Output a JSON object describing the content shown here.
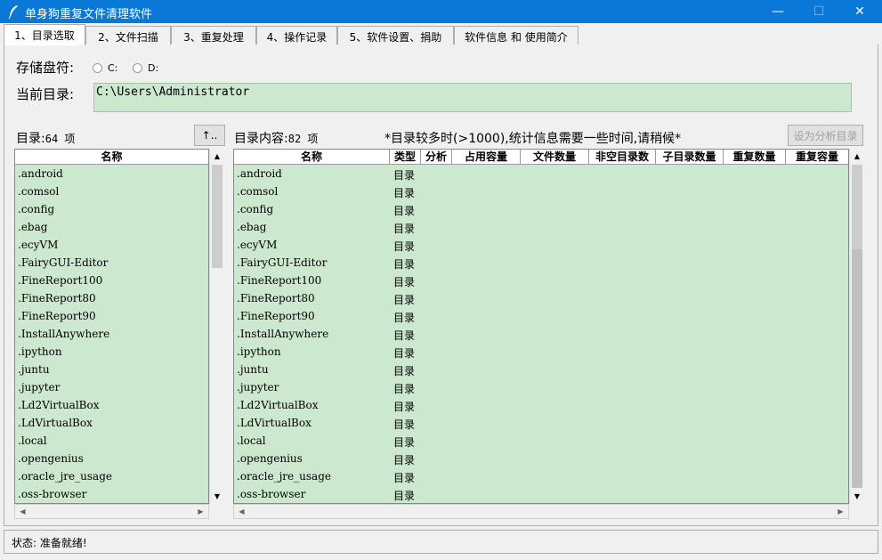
{
  "window": {
    "title": "单身狗重复文件清理软件",
    "min_glyph": "—",
    "max_glyph": "☐",
    "close_glyph": "✕"
  },
  "tabs": [
    {
      "label": "1、目录选取",
      "active": true
    },
    {
      "label": "2、文件扫描"
    },
    {
      "label": "3、重复处理"
    },
    {
      "label": "4、操作记录"
    },
    {
      "label": "5、软件设置、捐助"
    },
    {
      "label": "软件信息 和 使用简介"
    }
  ],
  "drive": {
    "label": "存储盘符:",
    "options": [
      "C:",
      "D:"
    ]
  },
  "current_dir": {
    "label": "当前目录:",
    "value": "C:\\Users\\Administrator"
  },
  "left_panel": {
    "count_label": "目录:",
    "count_value": "64 项",
    "up_button": "↑..",
    "column": "名称",
    "items": [
      ".android",
      ".comsol",
      ".config",
      ".ebag",
      ".ecyVM",
      ".FairyGUI-Editor",
      ".FineReport100",
      ".FineReport80",
      ".FineReport90",
      ".InstallAnywhere",
      ".ipython",
      ".juntu",
      ".jupyter",
      ".Ld2VirtualBox",
      ".LdVirtualBox",
      ".local",
      ".opengenius",
      ".oracle_jre_usage",
      ".oss-browser"
    ]
  },
  "right_panel": {
    "count_label": "目录内容:",
    "count_value": "82 项",
    "notice": "*目录较多时(>1000),统计信息需要一些时间,请稍候*",
    "set_button": "设为分析目录",
    "columns": [
      "名称",
      "类型",
      "分析",
      "占用容量",
      "文件数量",
      "非空目录数",
      "子目录数量",
      "重复数量",
      "重复容量"
    ],
    "type_value": "目录",
    "items": [
      ".android",
      ".comsol",
      ".config",
      ".ebag",
      ".ecyVM",
      ".FairyGUI-Editor",
      ".FineReport100",
      ".FineReport80",
      ".FineReport90",
      ".InstallAnywhere",
      ".ipython",
      ".juntu",
      ".jupyter",
      ".Ld2VirtualBox",
      ".LdVirtualBox",
      ".local",
      ".opengenius",
      ".oracle_jre_usage",
      ".oss-browser"
    ]
  },
  "status": "状态: 准备就绪!",
  "colors": {
    "titlebar": "#0a78d7",
    "list_bg": "#cce8cf"
  }
}
